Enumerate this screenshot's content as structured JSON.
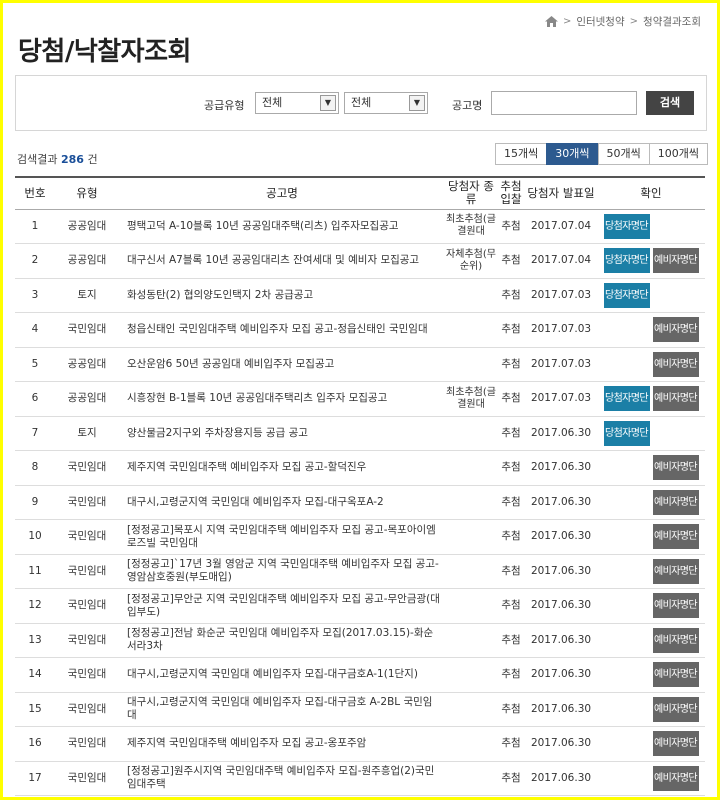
{
  "breadcrumb": {
    "items": [
      "인터넷청약",
      "청약결과조회"
    ]
  },
  "page": {
    "title": "당첨/낙찰자조회"
  },
  "search": {
    "supply_type_label": "공급유형",
    "select1_value": "전체",
    "select2_value": "전체",
    "notice_label": "공고명",
    "search_button": "검색"
  },
  "results": {
    "prefix": "검색결과",
    "count": "286",
    "suffix": "건",
    "per_page_options": [
      "15개씩",
      "30개씩",
      "50개씩",
      "100개씩"
    ],
    "active_per_page": "30개씩"
  },
  "table": {
    "headers": {
      "no": "번호",
      "type": "유형",
      "title": "공고명",
      "kind": "당첨자 종류",
      "method": "추첨 입찰",
      "date": "당첨자 발표일",
      "confirm": "확인"
    },
    "winner_label": "당첨자명단",
    "reserve_label": "예비자명단",
    "rows": [
      {
        "no": "1",
        "type": "공공임대",
        "title": "평택고덕 A-10블록 10년 공공임대주택(리츠) 입주자모집공고",
        "kind": "최초추첨(글결원대",
        "method": "추첨",
        "date": "2017.07.04",
        "winner": true,
        "reserve": false
      },
      {
        "no": "2",
        "type": "공공임대",
        "title": "대구신서 A7블록 10년 공공임대리츠 잔여세대 및 예비자 모집공고",
        "kind": "자체추첨(무순위)",
        "method": "추첨",
        "date": "2017.07.04",
        "winner": true,
        "reserve": true
      },
      {
        "no": "3",
        "type": "토지",
        "title": "화성동탄(2) 협의양도인택지 2차 공급공고",
        "kind": "",
        "method": "추첨",
        "date": "2017.07.03",
        "winner": true,
        "reserve": false
      },
      {
        "no": "4",
        "type": "국민임대",
        "title": "청읍신태인 국민임대주택 예비입주자 모집 공고-정읍신태인 국민임대",
        "kind": "",
        "method": "추첨",
        "date": "2017.07.03",
        "winner": false,
        "reserve": true
      },
      {
        "no": "5",
        "type": "공공임대",
        "title": "오산운암6 50년 공공임대 예비입주자 모집공고",
        "kind": "",
        "method": "추첨",
        "date": "2017.07.03",
        "winner": false,
        "reserve": true
      },
      {
        "no": "6",
        "type": "공공임대",
        "title": "시흥장현 B-1블록 10년 공공임대주택리츠 입주자 모집공고",
        "kind": "최초추첨(글결원대",
        "method": "추첨",
        "date": "2017.07.03",
        "winner": true,
        "reserve": true
      },
      {
        "no": "7",
        "type": "토지",
        "title": "양산물금2지구외 주차장용지등 공급 공고",
        "kind": "",
        "method": "추첨",
        "date": "2017.06.30",
        "winner": true,
        "reserve": false
      },
      {
        "no": "8",
        "type": "국민임대",
        "title": "제주지역 국민임대주택 예비입주자 모집 공고-할덕진우",
        "kind": "",
        "method": "추첨",
        "date": "2017.06.30",
        "winner": false,
        "reserve": true
      },
      {
        "no": "9",
        "type": "국민임대",
        "title": "대구시,고령군지역 국민임대 예비입주자 모집-대구옥포A-2",
        "kind": "",
        "method": "추첨",
        "date": "2017.06.30",
        "winner": false,
        "reserve": true
      },
      {
        "no": "10",
        "type": "국민임대",
        "title": "[정정공고]목포시 지역 국민임대주택 예비입주자 모집 공고-목포아이엠로즈빌 국민임대",
        "kind": "",
        "method": "추첨",
        "date": "2017.06.30",
        "winner": false,
        "reserve": true
      },
      {
        "no": "11",
        "type": "국민임대",
        "title": "[정정공고]`17년 3월 영암군 지역 국민임대주택 예비입주자 모집 공고-영암삼호중원(부도매입)",
        "kind": "",
        "method": "추첨",
        "date": "2017.06.30",
        "winner": false,
        "reserve": true
      },
      {
        "no": "12",
        "type": "국민임대",
        "title": "[정정공고]무안군 지역 국민임대주택 예비입주자 모집 공고-무안금광(대입부도)",
        "kind": "",
        "method": "추첨",
        "date": "2017.06.30",
        "winner": false,
        "reserve": true
      },
      {
        "no": "13",
        "type": "국민임대",
        "title": "[정정공고]전남 화순군 국민임대 예비입주자 모집(2017.03.15)-화순서라3차",
        "kind": "",
        "method": "추첨",
        "date": "2017.06.30",
        "winner": false,
        "reserve": true
      },
      {
        "no": "14",
        "type": "국민임대",
        "title": "대구시,고령군지역 국민임대 예비입주자 모집-대구금호A-1(1단지)",
        "kind": "",
        "method": "추첨",
        "date": "2017.06.30",
        "winner": false,
        "reserve": true
      },
      {
        "no": "15",
        "type": "국민임대",
        "title": "대구시,고령군지역 국민임대 예비입주자 모집-대구금호 A-2BL 국민임대",
        "kind": "",
        "method": "추첨",
        "date": "2017.06.30",
        "winner": false,
        "reserve": true
      },
      {
        "no": "16",
        "type": "국민임대",
        "title": "제주지역 국민임대주택 예비입주자 모집 공고-옹포주암",
        "kind": "",
        "method": "추첨",
        "date": "2017.06.30",
        "winner": false,
        "reserve": true
      },
      {
        "no": "17",
        "type": "국민임대",
        "title": "[정정공고]원주시지역 국민임대주택 예비입주자 모집-원주흥업(2)국민임대주택",
        "kind": "",
        "method": "추첨",
        "date": "2017.06.30",
        "winner": false,
        "reserve": true
      }
    ]
  }
}
